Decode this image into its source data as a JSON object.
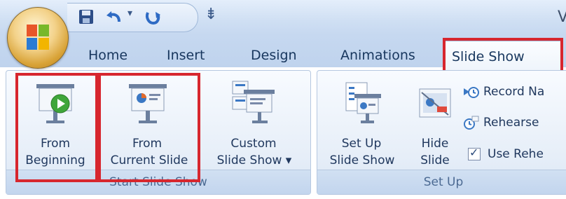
{
  "window": {
    "title_fragment": "V"
  },
  "tabs": [
    "Home",
    "Insert",
    "Design",
    "Animations",
    "Slide Show"
  ],
  "active_tab": "Slide Show",
  "groups": {
    "start": {
      "label": "Start Slide Show",
      "from_beginning": [
        "From",
        "Beginning"
      ],
      "from_current": [
        "From",
        "Current Slide"
      ],
      "custom": [
        "Custom",
        "Slide Show ▾"
      ]
    },
    "setup": {
      "label": "Set Up",
      "setup_show": [
        "Set Up",
        "Slide Show"
      ],
      "hide_slide": [
        "Hide",
        "Slide"
      ],
      "record": "Record Na",
      "rehearse": "Rehearse",
      "use_rehearsed": "Use Rehe"
    }
  },
  "highlight_color": "#d7262e",
  "qat_icons": [
    "save-icon",
    "undo-icon",
    "redo-icon",
    "customize-icon"
  ]
}
